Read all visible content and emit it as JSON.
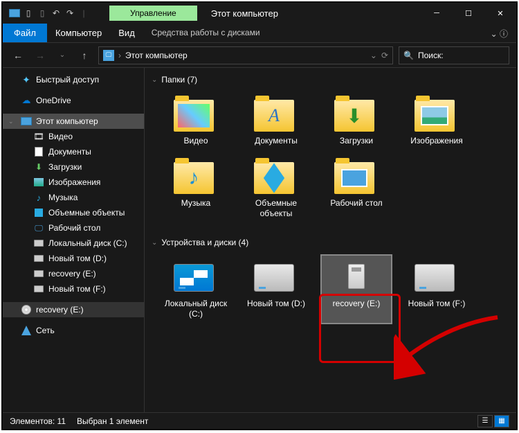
{
  "title": "Этот компьютер",
  "manage_tab": "Управление",
  "ribbon": {
    "file": "Файл",
    "tabs": [
      "Компьютер",
      "Вид"
    ],
    "subtab": "Средства работы с дисками"
  },
  "nav": {
    "breadcrumb": "Этот компьютер",
    "search_placeholder": "Поиск:"
  },
  "sidebar": {
    "quick_access": "Быстрый доступ",
    "onedrive": "OneDrive",
    "this_pc": "Этот компьютер",
    "children": [
      {
        "label": "Видео"
      },
      {
        "label": "Документы"
      },
      {
        "label": "Загрузки"
      },
      {
        "label": "Изображения"
      },
      {
        "label": "Музыка"
      },
      {
        "label": "Объемные объекты"
      },
      {
        "label": "Рабочий стол"
      },
      {
        "label": "Локальный диск (C:)"
      },
      {
        "label": "Новый том (D:)"
      },
      {
        "label": "recovery (E:)"
      },
      {
        "label": "Новый том (F:)"
      }
    ],
    "recovery_e": "recovery (E:)",
    "network": "Сеть"
  },
  "groups": {
    "folders": {
      "title": "Папки (7)",
      "items": [
        {
          "label": "Видео"
        },
        {
          "label": "Документы"
        },
        {
          "label": "Загрузки"
        },
        {
          "label": "Изображения"
        },
        {
          "label": "Музыка"
        },
        {
          "label": "Объемные объекты"
        },
        {
          "label": "Рабочий стол"
        }
      ]
    },
    "drives": {
      "title": "Устройства и диски (4)",
      "items": [
        {
          "label": "Локальный диск (C:)"
        },
        {
          "label": "Новый том (D:)"
        },
        {
          "label": "recovery (E:)"
        },
        {
          "label": "Новый том (F:)"
        }
      ]
    }
  },
  "status": {
    "count": "Элементов: 11",
    "selected": "Выбран 1 элемент"
  }
}
